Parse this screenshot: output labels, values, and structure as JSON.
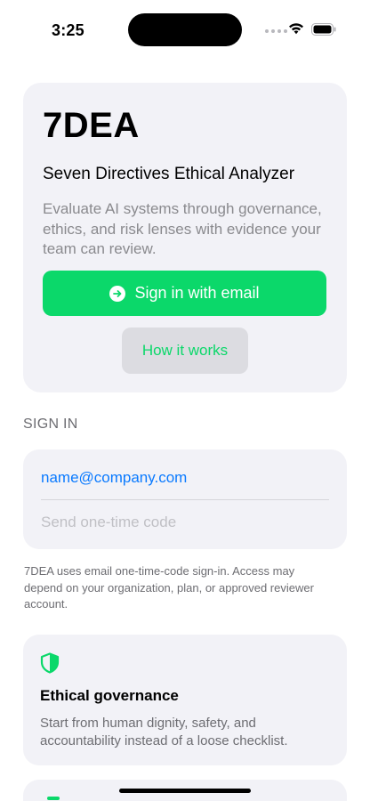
{
  "status_bar": {
    "time": "3:25"
  },
  "hero": {
    "brand": "7DEA",
    "subtitle": "Seven Directives Ethical Analyzer",
    "description": "Evaluate AI systems through governance, ethics, and risk lenses with evidence your team can review.",
    "primary_button_label": "Sign in with email",
    "secondary_button_label": "How it works"
  },
  "sign_in": {
    "header": "SIGN IN",
    "email_value": "name@company.com",
    "code_placeholder": "Send one-time code",
    "footnote": "7DEA uses email one-time-code sign-in. Access may depend on your organization, plan, or approved reviewer account."
  },
  "features": [
    {
      "icon": "shield-icon",
      "title": "Ethical governance",
      "description": "Start from human dignity, safety, and accountability instead of a loose checklist."
    }
  ],
  "colors": {
    "accent": "#0bd86a",
    "link": "#0a7aff",
    "card": "#f2f2f7"
  }
}
